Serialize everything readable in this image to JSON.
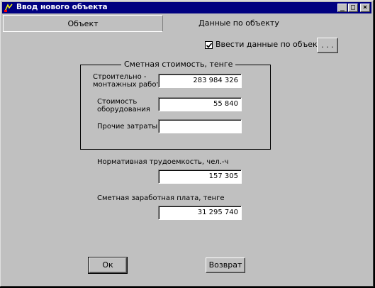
{
  "window": {
    "title": "Ввод нового объекта",
    "minimize_glyph": "_",
    "maximize_glyph": "□",
    "close_glyph": "×"
  },
  "tabs": [
    {
      "label": "Объект",
      "active": false
    },
    {
      "label": "Данные по объекту",
      "active": true
    }
  ],
  "checkbox": {
    "label": "Ввести данные по объекту",
    "checked": true
  },
  "ellipsis_button": {
    "label": ". . ."
  },
  "cost_group": {
    "title": "Сметная стоимость, тенге",
    "rows": [
      {
        "label_line1": "Строительно -",
        "label_line2": "монтажных работ",
        "value": "283 984 326"
      },
      {
        "label_line1": "Стоимость",
        "label_line2": "оборудования",
        "value": "55 840"
      },
      {
        "label_line1": "Прочие затраты",
        "label_line2": "",
        "value": ""
      }
    ]
  },
  "labor": {
    "label": "Нормативная трудоемкость, чел.-ч",
    "value": "157 305"
  },
  "salary": {
    "label": "Сметная заработная плата, тенге",
    "value": "31 295 740"
  },
  "buttons": {
    "ok": "Ок",
    "back": "Возврат"
  },
  "colors": {
    "titlebar": "#000080",
    "face": "#c0c0c0"
  },
  "icons": {
    "title": "app-icon",
    "check": "check-icon"
  }
}
